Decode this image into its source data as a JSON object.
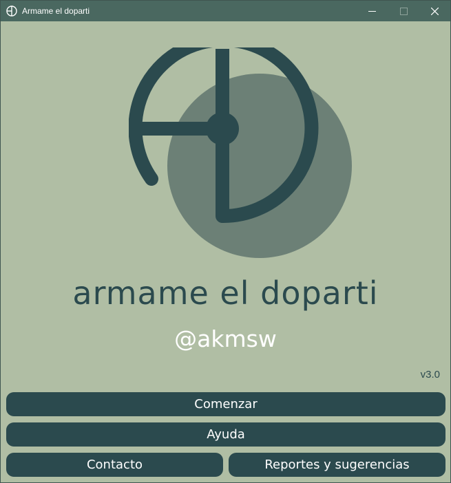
{
  "window": {
    "title": "Armame el doparti",
    "icon": "app-logo-icon",
    "controls": [
      "minimize-icon",
      "maximize-icon",
      "close-icon"
    ]
  },
  "main": {
    "logo": "ad-monogram-logo",
    "app_name": "armame el doparti",
    "handle": "@akmsw",
    "version": "v3.0"
  },
  "buttons": {
    "start_label": "Comenzar",
    "help_label": "Ayuda",
    "contact_label": "Contacto",
    "reports_label": "Reportes y sugerencias"
  },
  "colors": {
    "background": "#b0bea4",
    "titlebar": "#4a6860",
    "primary": "#2b4a4e",
    "logo_circle": "#6c8076",
    "text_light": "#ffffff"
  }
}
